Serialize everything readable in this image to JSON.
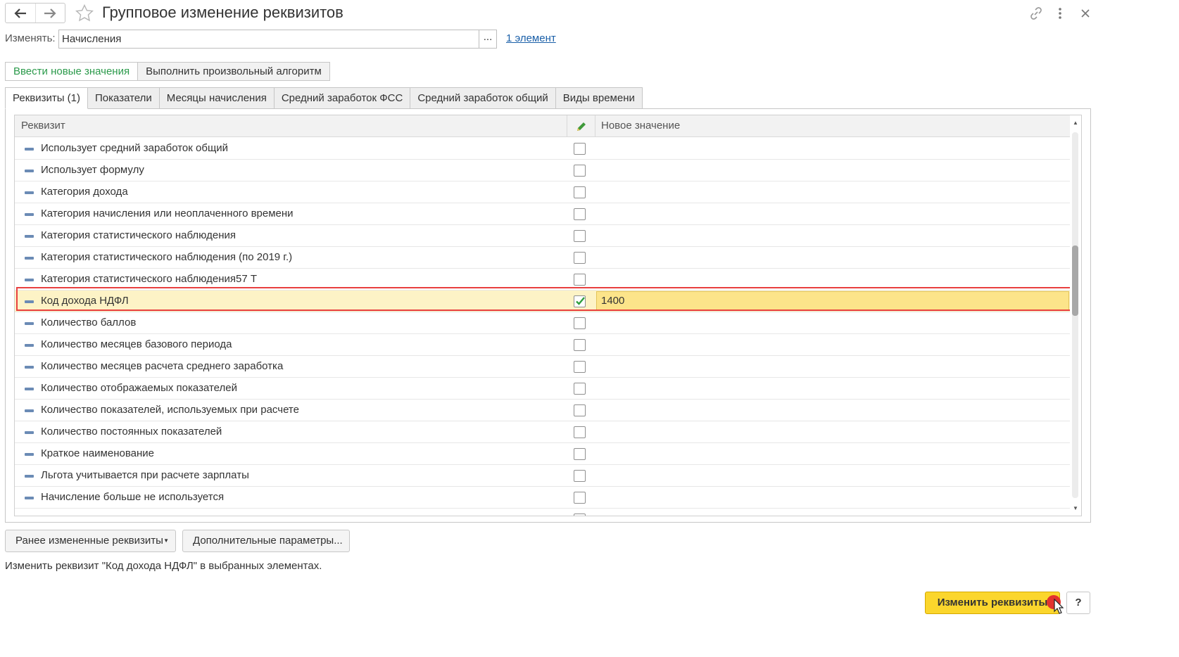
{
  "window": {
    "title": "Групповое изменение реквизитов"
  },
  "change_row": {
    "label": "Изменять:",
    "value": "Начисления",
    "choose_button": "...",
    "elements_link": "1 элемент"
  },
  "modes": [
    {
      "label": "Ввести новые значения",
      "active": true
    },
    {
      "label": "Выполнить произвольный алгоритм",
      "active": false
    }
  ],
  "tabs": [
    {
      "label": "Реквизиты (1)",
      "active": true
    },
    {
      "label": "Показатели",
      "active": false
    },
    {
      "label": "Месяцы начисления",
      "active": false
    },
    {
      "label": "Средний заработок ФСС",
      "active": false
    },
    {
      "label": "Средний заработок общий",
      "active": false
    },
    {
      "label": "Виды времени",
      "active": false
    }
  ],
  "grid": {
    "headers": {
      "attribute": "Реквизит",
      "edit_icon": "pencil-icon",
      "new_value": "Новое значение"
    },
    "rows": [
      {
        "name": "Использует средний заработок общий",
        "checked": false,
        "value": ""
      },
      {
        "name": "Использует формулу",
        "checked": false,
        "value": ""
      },
      {
        "name": "Категория дохода",
        "checked": false,
        "value": ""
      },
      {
        "name": "Категория начисления или неоплаченного времени",
        "checked": false,
        "value": ""
      },
      {
        "name": "Категория статистического наблюдения",
        "checked": false,
        "value": ""
      },
      {
        "name": "Категория статистического наблюдения (по 2019 г.)",
        "checked": false,
        "value": ""
      },
      {
        "name": "Категория статистического наблюдения57 Т",
        "checked": false,
        "value": ""
      },
      {
        "name": "Код дохода НДФЛ",
        "checked": true,
        "value": "1400",
        "selected": true
      },
      {
        "name": "Количество баллов",
        "checked": false,
        "value": ""
      },
      {
        "name": "Количество месяцев базового периода",
        "checked": false,
        "value": ""
      },
      {
        "name": "Количество месяцев расчета среднего заработка",
        "checked": false,
        "value": ""
      },
      {
        "name": "Количество отображаемых показателей",
        "checked": false,
        "value": ""
      },
      {
        "name": "Количество показателей, используемых при расчете",
        "checked": false,
        "value": ""
      },
      {
        "name": "Количество постоянных показателей",
        "checked": false,
        "value": ""
      },
      {
        "name": "Краткое наименование",
        "checked": false,
        "value": ""
      },
      {
        "name": "Льгота учитывается при расчете зарплаты",
        "checked": false,
        "value": ""
      },
      {
        "name": "Начисление больше не используется",
        "checked": false,
        "value": ""
      },
      {
        "name": "",
        "checked": false,
        "value": ""
      }
    ]
  },
  "bottom": {
    "previous_button": "Ранее измененные реквизиты",
    "additional_button": "Дополнительные параметры...",
    "hint": "Изменить реквизит \"Код дохода НДФЛ\" в выбранных элементах.",
    "submit_button": "Изменить реквизиты",
    "help_button": "?"
  },
  "colors": {
    "accent_yellow": "#fbd62c",
    "selected_row": "#fdf3c6",
    "highlight_border": "#e8403f",
    "active_mode_text": "#2b9a4b",
    "link": "#1a5fa8"
  }
}
